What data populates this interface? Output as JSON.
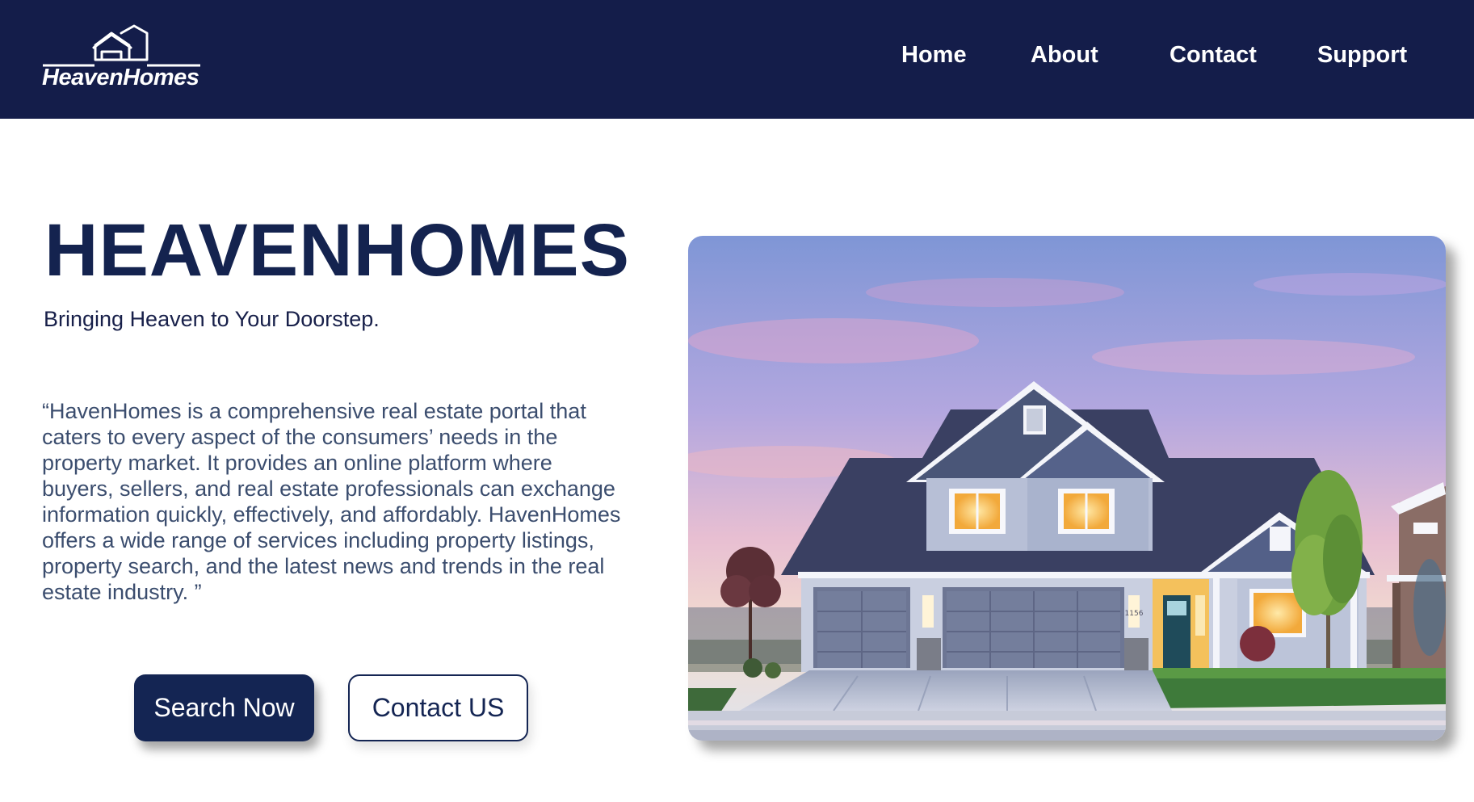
{
  "brand": {
    "logo_text": "HeavenHomes",
    "logo_icon": "house-outline-icon"
  },
  "nav": {
    "items": [
      {
        "label": "Home"
      },
      {
        "label": "About"
      },
      {
        "label": "Contact"
      },
      {
        "label": "Support"
      }
    ]
  },
  "hero": {
    "title": "HEAVENHOMES",
    "subtitle": "Bringing Heaven to Your Doorstep.",
    "description": "“HavenHomes is a comprehensive real estate portal that caters to every aspect of the consumers’ needs in the property market. It provides an online platform where buyers, sellers, and real estate professionals can exchange information quickly, effectively, and affordably. HavenHomes offers a wide range of services including property listings, property search, and the latest news and trends in the real estate industry. ”",
    "primary_button": "Search Now",
    "secondary_button": "Contact US",
    "image": {
      "house_number": "1156"
    }
  },
  "colors": {
    "navbar_bg": "#141d4a",
    "title": "#14234f",
    "body_text": "#3b4d6e",
    "button_primary": "#142553"
  }
}
